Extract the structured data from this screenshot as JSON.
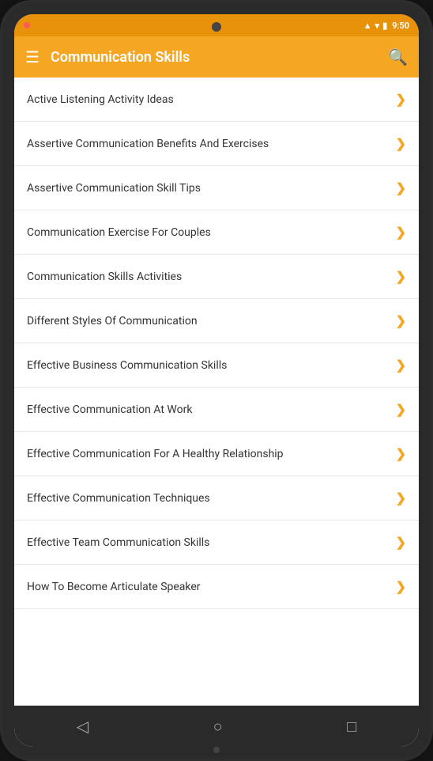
{
  "device": {
    "status_bar": {
      "time": "9:50",
      "dot_color": "#ff5a5a"
    },
    "toolbar": {
      "title": "Communication Skills",
      "hamburger_label": "☰",
      "search_label": "🔍"
    },
    "list": {
      "items": [
        {
          "id": 1,
          "label": "Active Listening Activity Ideas"
        },
        {
          "id": 2,
          "label": "Assertive Communication Benefits And Exercises"
        },
        {
          "id": 3,
          "label": "Assertive Communication Skill Tips"
        },
        {
          "id": 4,
          "label": "Communication Exercise For Couples"
        },
        {
          "id": 5,
          "label": "Communication Skills Activities"
        },
        {
          "id": 6,
          "label": "Different Styles Of Communication"
        },
        {
          "id": 7,
          "label": "Effective Business Communication Skills"
        },
        {
          "id": 8,
          "label": "Effective Communication At Work"
        },
        {
          "id": 9,
          "label": "Effective Communication For A Healthy Relationship"
        },
        {
          "id": 10,
          "label": "Effective Communication Techniques"
        },
        {
          "id": 11,
          "label": "Effective Team Communication Skills"
        },
        {
          "id": 12,
          "label": "How To Become Articulate Speaker"
        }
      ],
      "chevron": "❯"
    },
    "nav_bar": {
      "back_icon": "◁",
      "home_icon": "○",
      "recents_icon": "□"
    }
  }
}
